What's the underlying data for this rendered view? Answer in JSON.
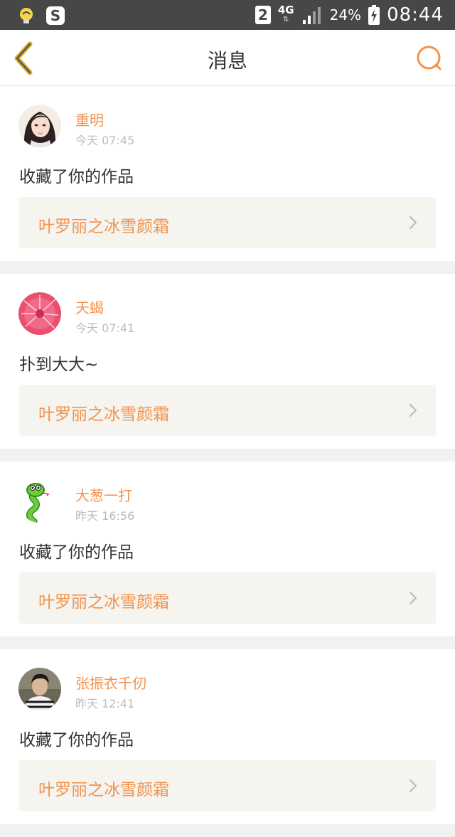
{
  "status_bar": {
    "sim_slot": "2",
    "network": "4G",
    "battery": "24%",
    "time": "08:44",
    "left_icons": [
      "app-bulb-icon",
      "s-app-icon"
    ]
  },
  "header": {
    "title": "消息",
    "back_icon": "chevron-left-icon",
    "search_icon": "search-icon",
    "accent_color": "#f3924d"
  },
  "messages": [
    {
      "user": "重明",
      "time": "今天 07:45",
      "text": "收藏了你的作品",
      "work": "叶罗丽之冰雪颜霜",
      "avatar": "girl-portrait"
    },
    {
      "user": "天蝎",
      "time": "今天 07:41",
      "text": "扑到大大~",
      "work": "叶罗丽之冰雪颜霜",
      "avatar": "pink-flower"
    },
    {
      "user": "大葱一打",
      "time": "昨天 16:56",
      "text": "收藏了你的作品",
      "work": "叶罗丽之冰雪颜霜",
      "avatar": "cartoon-snake"
    },
    {
      "user": "张振衣千仞",
      "time": "昨天 12:41",
      "text": "收藏了你的作品",
      "work": "叶罗丽之冰雪颜霜",
      "avatar": "boy-photo"
    }
  ]
}
